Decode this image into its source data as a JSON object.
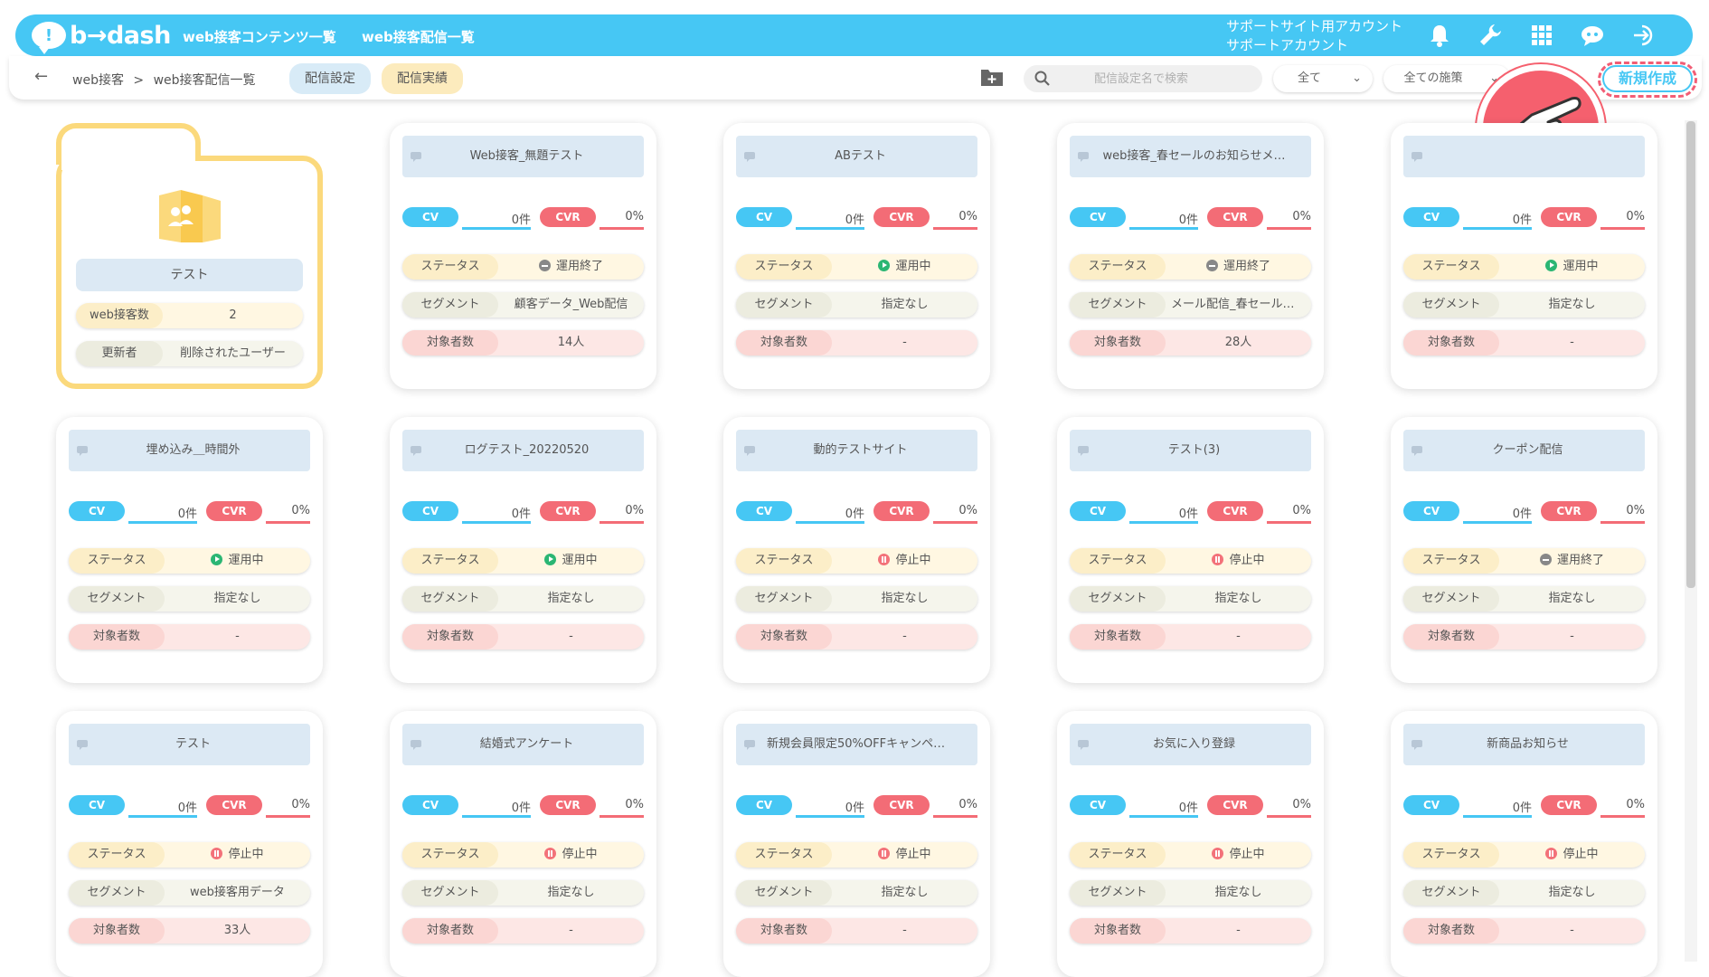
{
  "navbar": {
    "logo_text": "b→dash",
    "nav_links": [
      "web接客コンテンツ一覧",
      "web接客配信一覧"
    ],
    "account_line1": "サポートサイト用アカウント",
    "account_line2": "サポートアカウント",
    "icons": [
      "bell-icon",
      "wrench-icon",
      "grid-icon",
      "chat-support-icon",
      "logout-icon"
    ],
    "color": "#46c7f4"
  },
  "subbar": {
    "breadcrumb": [
      "web接客",
      ">",
      "web接客配信一覧"
    ],
    "tabs": [
      {
        "label": "配信設定",
        "active": true
      },
      {
        "label": "配信実績",
        "active": false
      }
    ],
    "search_placeholder": "配信設定名で検索",
    "filter1": "全て",
    "filter2": "全ての施策",
    "new_button": "新規作成"
  },
  "folder": {
    "name": "テスト",
    "rows": [
      {
        "label": "web接客数",
        "value": "2"
      },
      {
        "label": "更新者",
        "value": "削除されたユーザー"
      }
    ]
  },
  "labels": {
    "cv": "CV",
    "cvr": "CVR",
    "status": "ステータス",
    "segment": "セグメント",
    "target": "対象者数"
  },
  "cards": [
    {
      "title": "Web接客_無題テスト",
      "cv": "0件",
      "cvr": "0%",
      "status": "運用終了",
      "status_type": "ended",
      "segment": "顧客データ_Web配信",
      "target": "14人"
    },
    {
      "title": "ABテスト",
      "cv": "0件",
      "cvr": "0%",
      "status": "運用中",
      "status_type": "running",
      "segment": "指定なし",
      "target": "-"
    },
    {
      "title": "web接客_春セールのお知らせメ…",
      "cv": "0件",
      "cvr": "0%",
      "status": "運用終了",
      "status_type": "ended",
      "segment": "メール配信_春セールの…",
      "target": "28人"
    },
    {
      "title": "",
      "cv": "0件",
      "cvr": "0%",
      "status": "運用中",
      "status_type": "running",
      "segment": "指定なし",
      "target": "-"
    },
    {
      "title": "埋め込み＿時間外",
      "cv": "0件",
      "cvr": "0%",
      "status": "運用中",
      "status_type": "running",
      "segment": "指定なし",
      "target": "-"
    },
    {
      "title": "ログテスト_20220520",
      "cv": "0件",
      "cvr": "0%",
      "status": "運用中",
      "status_type": "running",
      "segment": "指定なし",
      "target": "-"
    },
    {
      "title": "動的テストサイト",
      "cv": "0件",
      "cvr": "0%",
      "status": "停止中",
      "status_type": "stopped",
      "segment": "指定なし",
      "target": "-"
    },
    {
      "title": "テスト(3)",
      "cv": "0件",
      "cvr": "0%",
      "status": "停止中",
      "status_type": "stopped",
      "segment": "指定なし",
      "target": "-"
    },
    {
      "title": "クーポン配信",
      "cv": "0件",
      "cvr": "0%",
      "status": "運用終了",
      "status_type": "ended",
      "segment": "指定なし",
      "target": "-"
    },
    {
      "title": "テスト",
      "cv": "0件",
      "cvr": "0%",
      "status": "停止中",
      "status_type": "stopped",
      "segment": "web接客用データ",
      "target": "33人"
    },
    {
      "title": "結婚式アンケート",
      "cv": "0件",
      "cvr": "0%",
      "status": "停止中",
      "status_type": "stopped",
      "segment": "指定なし",
      "target": "-"
    },
    {
      "title": "新規会員限定50%OFFキャンペーン",
      "cv": "0件",
      "cvr": "0%",
      "status": "停止中",
      "status_type": "stopped",
      "segment": "指定なし",
      "target": "-"
    },
    {
      "title": "お気に入り登録",
      "cv": "0件",
      "cvr": "0%",
      "status": "停止中",
      "status_type": "stopped",
      "segment": "指定なし",
      "target": "-"
    },
    {
      "title": "新商品お知らせ",
      "cv": "0件",
      "cvr": "0%",
      "status": "停止中",
      "status_type": "stopped",
      "segment": "指定なし",
      "target": "-"
    }
  ]
}
